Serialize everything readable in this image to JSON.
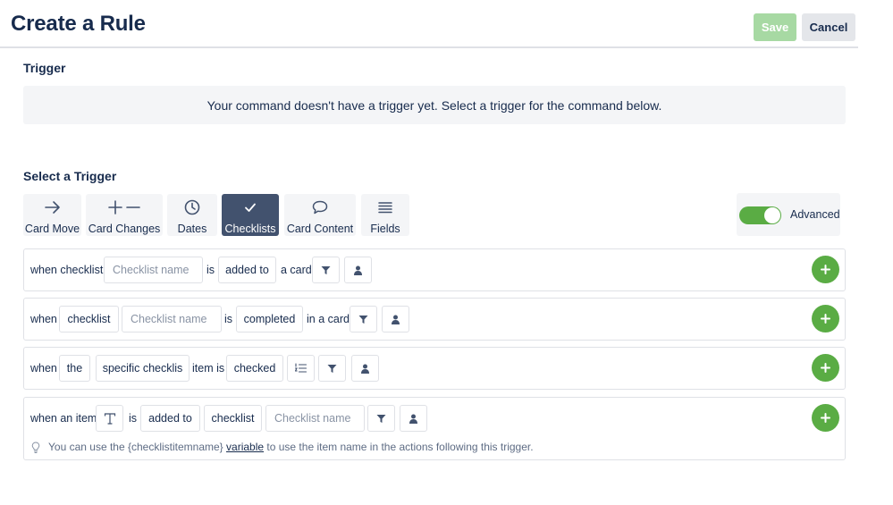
{
  "header": {
    "title": "Create a Rule",
    "save_label": "Save",
    "cancel_label": "Cancel"
  },
  "trigger": {
    "heading": "Trigger",
    "notice": "Your command doesn't have a trigger yet. Select a trigger for the command below."
  },
  "select_trigger": {
    "heading": "Select a Trigger",
    "tabs": [
      {
        "label": "Card Move",
        "icon": "arrow-right-icon",
        "active": false
      },
      {
        "label": "Card Changes",
        "icon": "plus-minus-icon",
        "active": false
      },
      {
        "label": "Dates",
        "icon": "clock-icon",
        "active": false
      },
      {
        "label": "Checklists",
        "icon": "checkmark-icon",
        "active": true
      },
      {
        "label": "Card Content",
        "icon": "comment-icon",
        "active": false
      },
      {
        "label": "Fields",
        "icon": "lines-icon",
        "active": false
      }
    ],
    "advanced_label": "Advanced",
    "advanced_enabled": true
  },
  "rules": {
    "row1": {
      "prefix": "when checklist",
      "checklist_placeholder": "Checklist name",
      "is": "is",
      "action": "added to",
      "suffix": "a card"
    },
    "row2": {
      "prefix": "when",
      "subject": "checklist",
      "checklist_placeholder": "Checklist name",
      "is": "is",
      "action": "completed",
      "suffix": "in a card"
    },
    "row3": {
      "prefix": "when",
      "article": "the",
      "specific": "specific checklis",
      "item_is": "item is",
      "state": "checked"
    },
    "row4": {
      "prefix": "when an item",
      "is": "is",
      "action": "added to",
      "subject": "checklist",
      "checklist_placeholder": "Checklist name",
      "hint_before": "You can use the {checklistitemname}",
      "hint_link": "variable",
      "hint_after": "to use the item name in the actions following this trigger."
    }
  },
  "colors": {
    "accent_green": "#5aac44",
    "save_disabled": "#a7d9a3",
    "active_tab": "#42526e",
    "text": "#172b4d"
  }
}
